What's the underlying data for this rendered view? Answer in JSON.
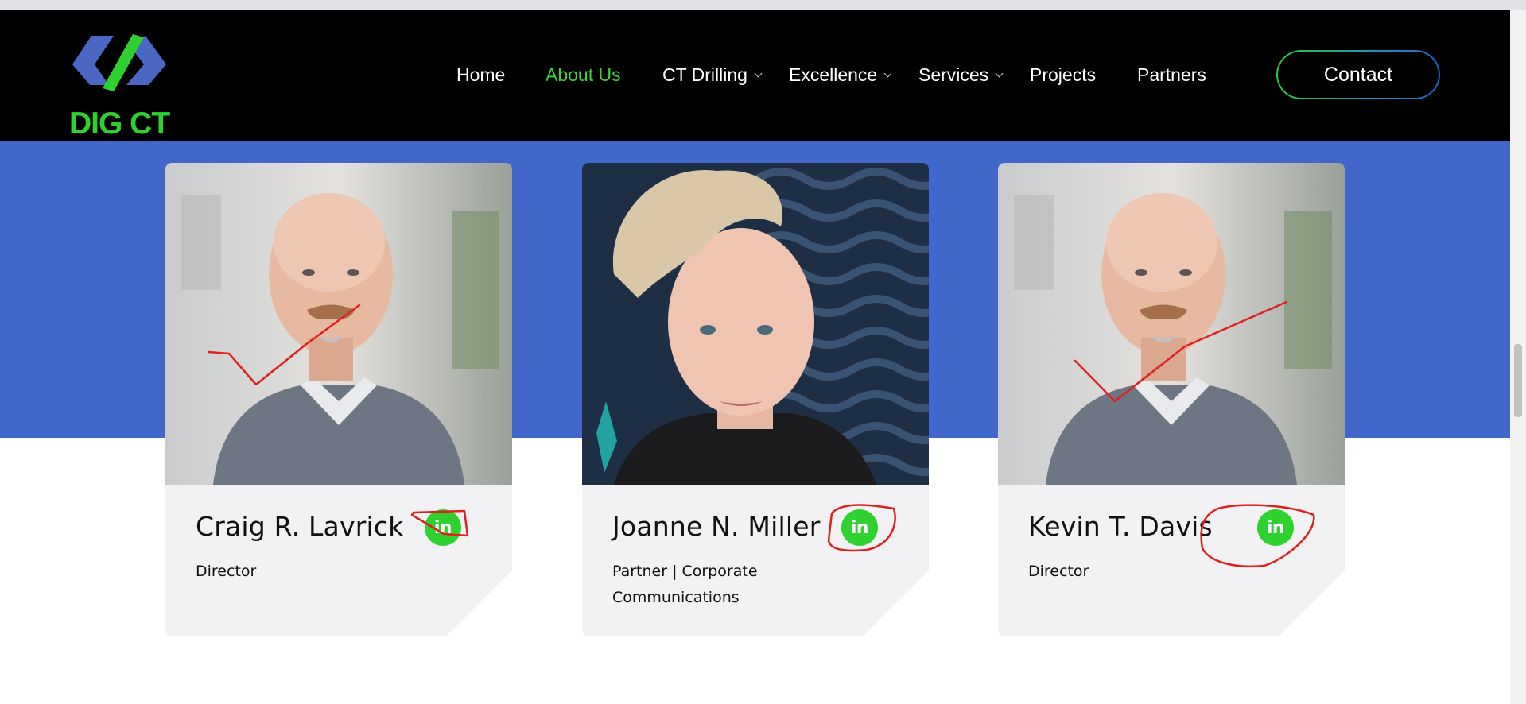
{
  "brand": {
    "logo_text": "DIG CT",
    "logo_icon": "dig-ct-logo",
    "colors": {
      "green": "#2fd12f",
      "blue": "#4067c9",
      "header_bg": "#000000"
    }
  },
  "nav": {
    "items": [
      {
        "label": "Home",
        "active": false,
        "has_dropdown": false
      },
      {
        "label": "About Us",
        "active": true,
        "has_dropdown": false
      },
      {
        "label": "CT Drilling",
        "active": false,
        "has_dropdown": true
      },
      {
        "label": "Excellence",
        "active": false,
        "has_dropdown": true
      },
      {
        "label": "Services",
        "active": false,
        "has_dropdown": true
      },
      {
        "label": "Projects",
        "active": false,
        "has_dropdown": false
      },
      {
        "label": "Partners",
        "active": false,
        "has_dropdown": false
      }
    ],
    "contact_label": "Contact"
  },
  "team": [
    {
      "name": "Craig R. Lavrick",
      "role": "Director",
      "linkedin_label": "in"
    },
    {
      "name": "Joanne N. Miller",
      "role": "Partner | Corporate Communications",
      "linkedin_label": "in"
    },
    {
      "name": "Kevin T. Davis",
      "role": "Director",
      "linkedin_label": "in"
    }
  ]
}
